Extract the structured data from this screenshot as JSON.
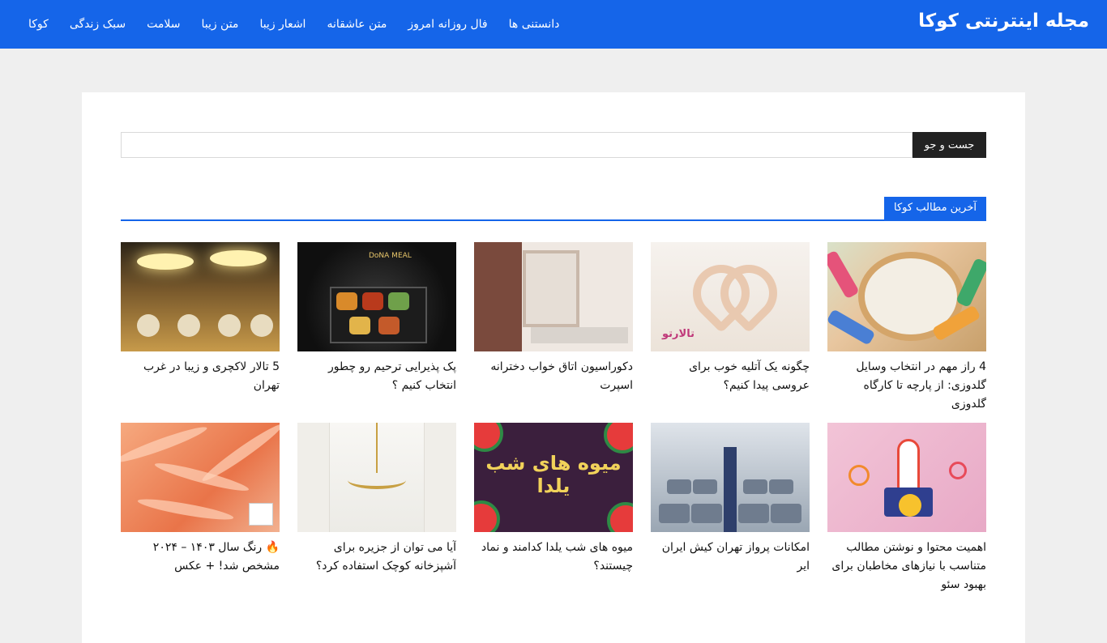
{
  "header": {
    "title": "مجله اینترنتی کوکا",
    "nav": [
      "کوکا",
      "سبک زندگی",
      "سلامت",
      "متن زیبا",
      "اشعار زیبا",
      "متن عاشقانه",
      "فال روزانه امروز",
      "دانستنی ها"
    ]
  },
  "search": {
    "button_label": "جست و جو",
    "value": ""
  },
  "latest": {
    "heading": "آخرین مطالب کوکا",
    "posts": [
      {
        "title": "4 راز مهم در انتخاب وسایل گلدوزی: از پارچه تا کارگاه گلدوزی"
      },
      {
        "title": "چگونه یک آتلیه خوب برای عروسی پیدا کنیم؟"
      },
      {
        "title": "دکوراسیون اتاق خواب دخترانه اسپرت"
      },
      {
        "title": "پک پذیرایی ترحیم رو چطور انتخاب کنیم ؟"
      },
      {
        "title": "5 تالار لاکچری و زیبا در غرب تهران"
      },
      {
        "title": "اهمیت محتوا و نوشتن مطالب متناسب با نیازهای مخاطبان برای بهبود سئو"
      },
      {
        "title": "امکانات پرواز تهران کیش ایران ایر"
      },
      {
        "title": "میوه های شب یلدا کدامند و نماد چیستند؟"
      },
      {
        "title": "آیا می توان از جزیره برای آشپزخانه کوچک استفاده کرد؟"
      },
      {
        "title": "🔥 رنگ سال ۱۴۰۳ – ۲۰۲۴ مشخص شد! + عکس"
      }
    ],
    "thumb_texts": {
      "wedding_logo": "تالارتو",
      "yalda": "میوه های شب یلدا",
      "meal": "DoNA MEAL"
    }
  },
  "colors": {
    "brand": "#1565e9",
    "search_button": "#222222"
  }
}
